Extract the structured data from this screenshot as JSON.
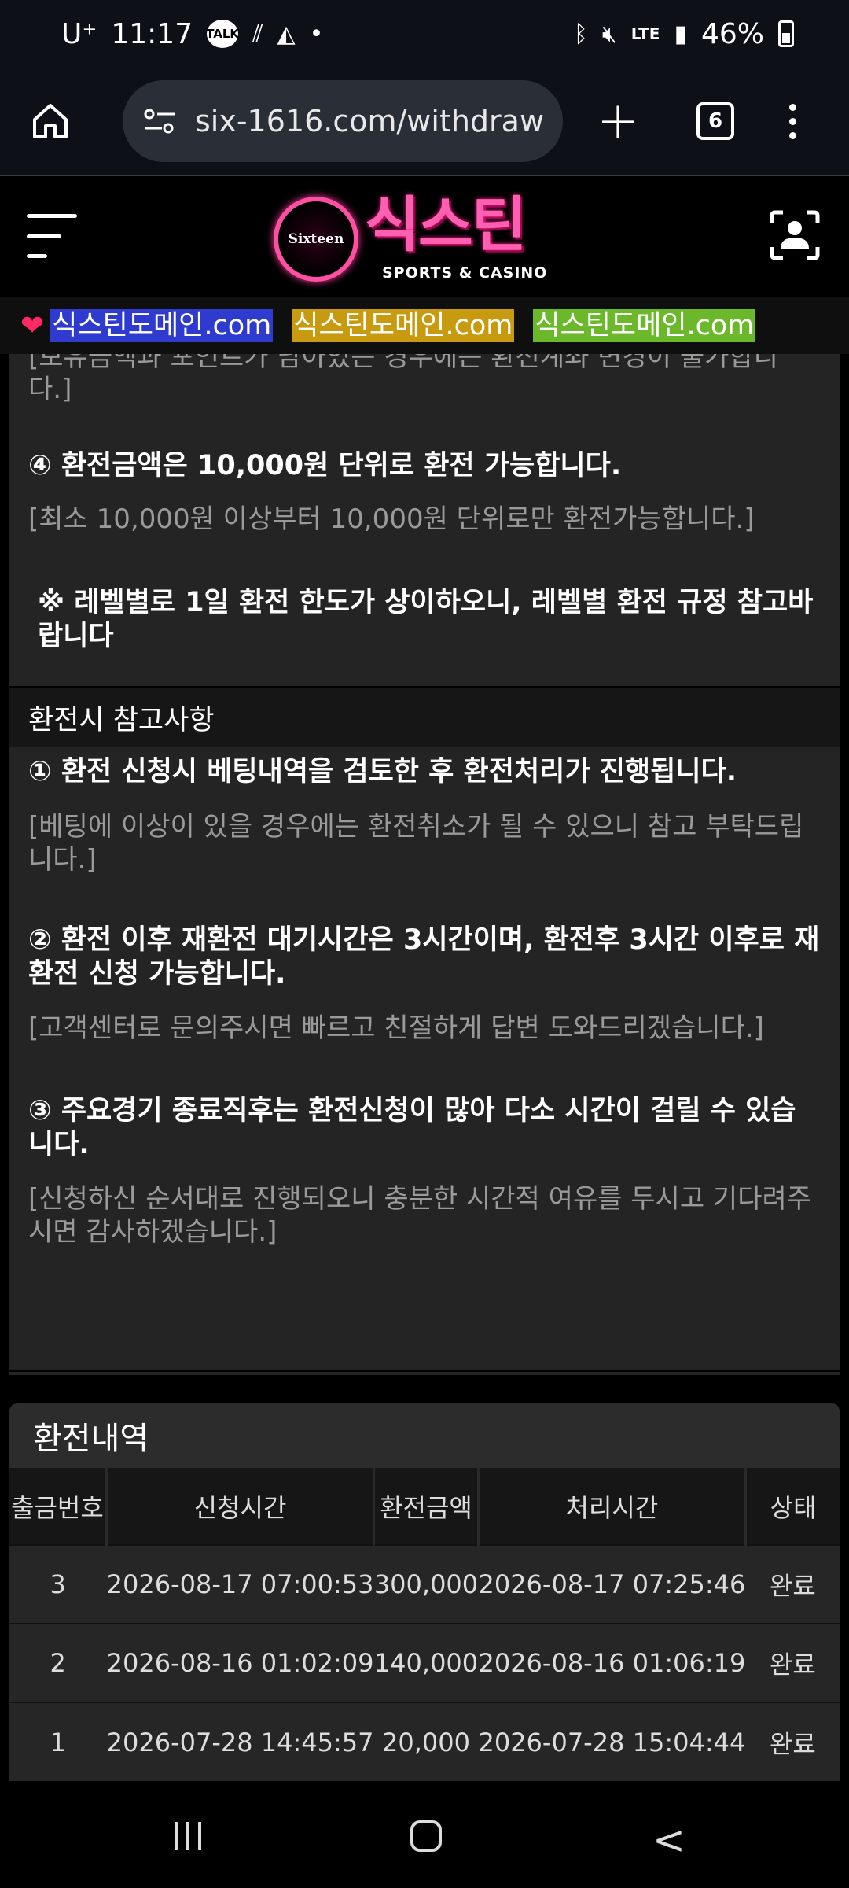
{
  "status": {
    "carrier": "U⁺",
    "time": "11:17",
    "talk": "TALK",
    "lte": "LTE",
    "battery": "46%"
  },
  "browser": {
    "url": "six-1616.com/withdraw",
    "tab_count": "6"
  },
  "site": {
    "logo_badge": "Sixteen",
    "logo_text": "식스틴",
    "logo_sub": "SPORTS & CASINO",
    "domains": [
      "식스틴도메인.com",
      "식스틴도메인.com",
      "식스틴도메인.com"
    ]
  },
  "rules": {
    "top_cut": "[보유금액과 포인트가 남아있는 경우에는 환전계좌 변경이 불가합니다.]",
    "rule4_title": "④ 환전금액은 10,000원 단위로 환전 가능합니다.",
    "rule4_note": "[최소 10,000원 이상부터 10,000원 단위로만 환전가능합니다.]",
    "level_note": "※ 레벨별로 1일 환전 한도가 상이하오니, 레벨별 환전 규정 참고바랍니다"
  },
  "reference": {
    "heading": "환전시 참고사항",
    "items": [
      {
        "title": "① 환전 신청시 베팅내역을 검토한 후 환전처리가 진행됩니다.",
        "note": "[베팅에 이상이 있을 경우에는 환전취소가 될 수 있으니 참고 부탁드립니다.]"
      },
      {
        "title": "② 환전 이후 재환전 대기시간은 3시간이며, 환전후 3시간 이후로 재환전 신청 가능합니다.",
        "note": "[고객센터로 문의주시면 빠르고 친절하게 답변 도와드리겠습니다.]"
      },
      {
        "title": "③ 주요경기 종료직후는 환전신청이 많아 다소 시간이 걸릴 수 있습니다.",
        "note": "[신청하신 순서대로 진행되오니 충분한 시간적 여유를 두시고 기다려주시면 감사하겠습니다.]"
      }
    ]
  },
  "history": {
    "title": "환전내역",
    "columns": [
      "출금번호",
      "신청시간",
      "환전금액",
      "처리시간",
      "상태"
    ],
    "rows": [
      [
        "3",
        "2026-08-17 07:00:53",
        "300,000",
        "2026-08-17 07:25:46",
        "완료"
      ],
      [
        "2",
        "2026-08-16 01:02:09",
        "140,000",
        "2026-08-16 01:06:19",
        "완료"
      ],
      [
        "1",
        "2026-07-28 14:45:57",
        "20,000",
        "2026-07-28 15:04:44",
        "완료"
      ]
    ]
  }
}
